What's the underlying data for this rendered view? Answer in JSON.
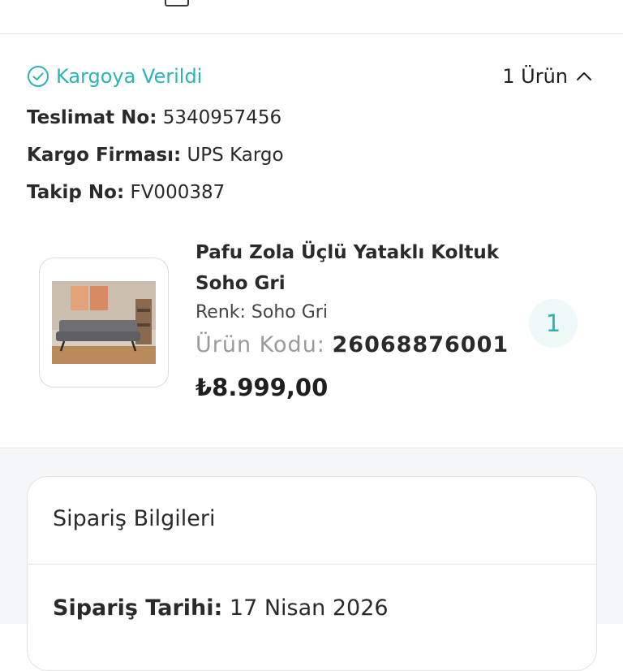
{
  "shipment": {
    "status_label": "Kargoya Verildi",
    "item_count_label": "1 Ürün",
    "delivery_no": {
      "label": "Teslimat No:",
      "value": "5340957456"
    },
    "carrier": {
      "label": "Kargo Firması:",
      "value": "UPS Kargo"
    },
    "tracking_no": {
      "label": "Takip No:",
      "value": "FV000387"
    }
  },
  "product": {
    "name": "Pafu Zola Üçlü Yataklı Koltuk Soho Gri",
    "color": "Renk: Soho Gri",
    "code_label": "Ürün Kodu:",
    "code_value": "26068876001",
    "price": "₺8.999,00",
    "quantity": "1"
  },
  "order_info": {
    "title": "Sipariş Bilgileri",
    "date_label": "Sipariş Tarihi:",
    "date_value": "17 Nisan 2026"
  },
  "colors": {
    "accent": "#2cb3b8",
    "badge_bg": "#eef8f9",
    "page_bg": "#f4f6f9"
  }
}
